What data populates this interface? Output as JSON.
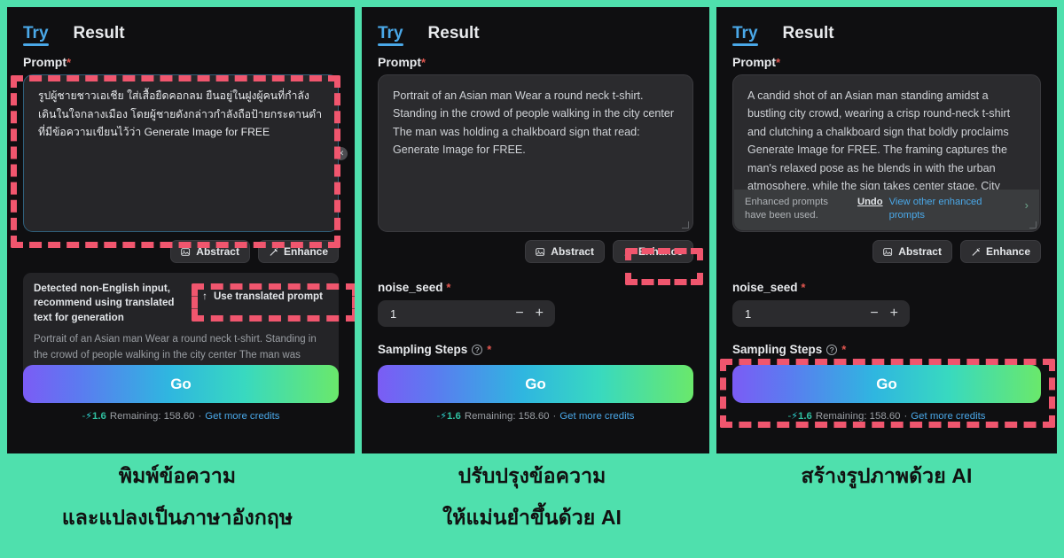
{
  "theme": {
    "background": "#4fe0ad",
    "panel_bg": "#0f0f11",
    "accent_blue": "#4aa8e8",
    "highlight_red": "#f0566e",
    "required_red": "#e0564f"
  },
  "tabs": {
    "try": "Try",
    "result": "Result"
  },
  "labels": {
    "prompt": "Prompt",
    "required_mark": "*",
    "noise_seed": "noise_seed",
    "sampling_steps": "Sampling Steps"
  },
  "buttons": {
    "abstract": "Abstract",
    "enhance": "Enhance",
    "go": "Go",
    "use_translated": "Use translated prompt",
    "undo": "Undo",
    "view_other": "View other enhanced prompts"
  },
  "icons": {
    "abstract": "image-frame-icon",
    "enhance": "magic-wand-icon",
    "use_translated": "arrow-up-icon",
    "clear": "close-icon",
    "help": "question-mark-icon",
    "chevron": "chevron-right-icon"
  },
  "panel1": {
    "prompt_value": "รูปผู้ชายชาวเอเชีย ใส่เสื้อยืดคอกลม ยืนอยู่ในฝูงผู้คนที่กำลังเดินในใจกลางเมือง โดยผู้ชายดังกล่าวกำลังถือป้ายกระดานดำที่มีข้อความเขียนไว้ว่า Generate Image for FREE",
    "notice_message": "Detected non-English input, recommend using translated text for generation",
    "notice_translation": "Portrait of an Asian man Wear a round neck t-shirt. Standing in the crowd of people walking in the city center The man was holding a chalkboard sign that read: Generate Image for FREE."
  },
  "panel2": {
    "prompt_value": "Portrait of an Asian man Wear a round neck t-shirt. Standing in the crowd of people walking in the city center The man was holding a chalkboard sign that read: Generate Image for FREE.",
    "noise_seed_value": "1"
  },
  "panel3": {
    "prompt_value": "A candid shot of an Asian man standing amidst a bustling city crowd, wearing a crisp round-neck t-shirt and clutching a chalkboard sign that boldly proclaims Generate Image for FREE. The framing captures the man's relaxed pose as he blends in with the urban atmosphere, while the sign takes center stage. City lights and sounds hum in the background, highlighting",
    "enhanced_note": "Enhanced prompts have been used.",
    "noise_seed_value": "1"
  },
  "credits": {
    "minus": "-",
    "bolt": "⚡",
    "amount": "1.6",
    "remaining_label": "Remaining: 158.60",
    "separator": "·",
    "link": "Get more credits"
  },
  "captions": {
    "c1_line1": "พิมพ์ข้อความ",
    "c1_line2": "และแปลงเป็นภาษาอังกฤษ",
    "c2_line1": "ปรับปรุงข้อความ",
    "c2_line2": "ให้แม่นยำขึ้นด้วย AI",
    "c3_line1": "สร้างรูปภาพด้วย AI"
  }
}
